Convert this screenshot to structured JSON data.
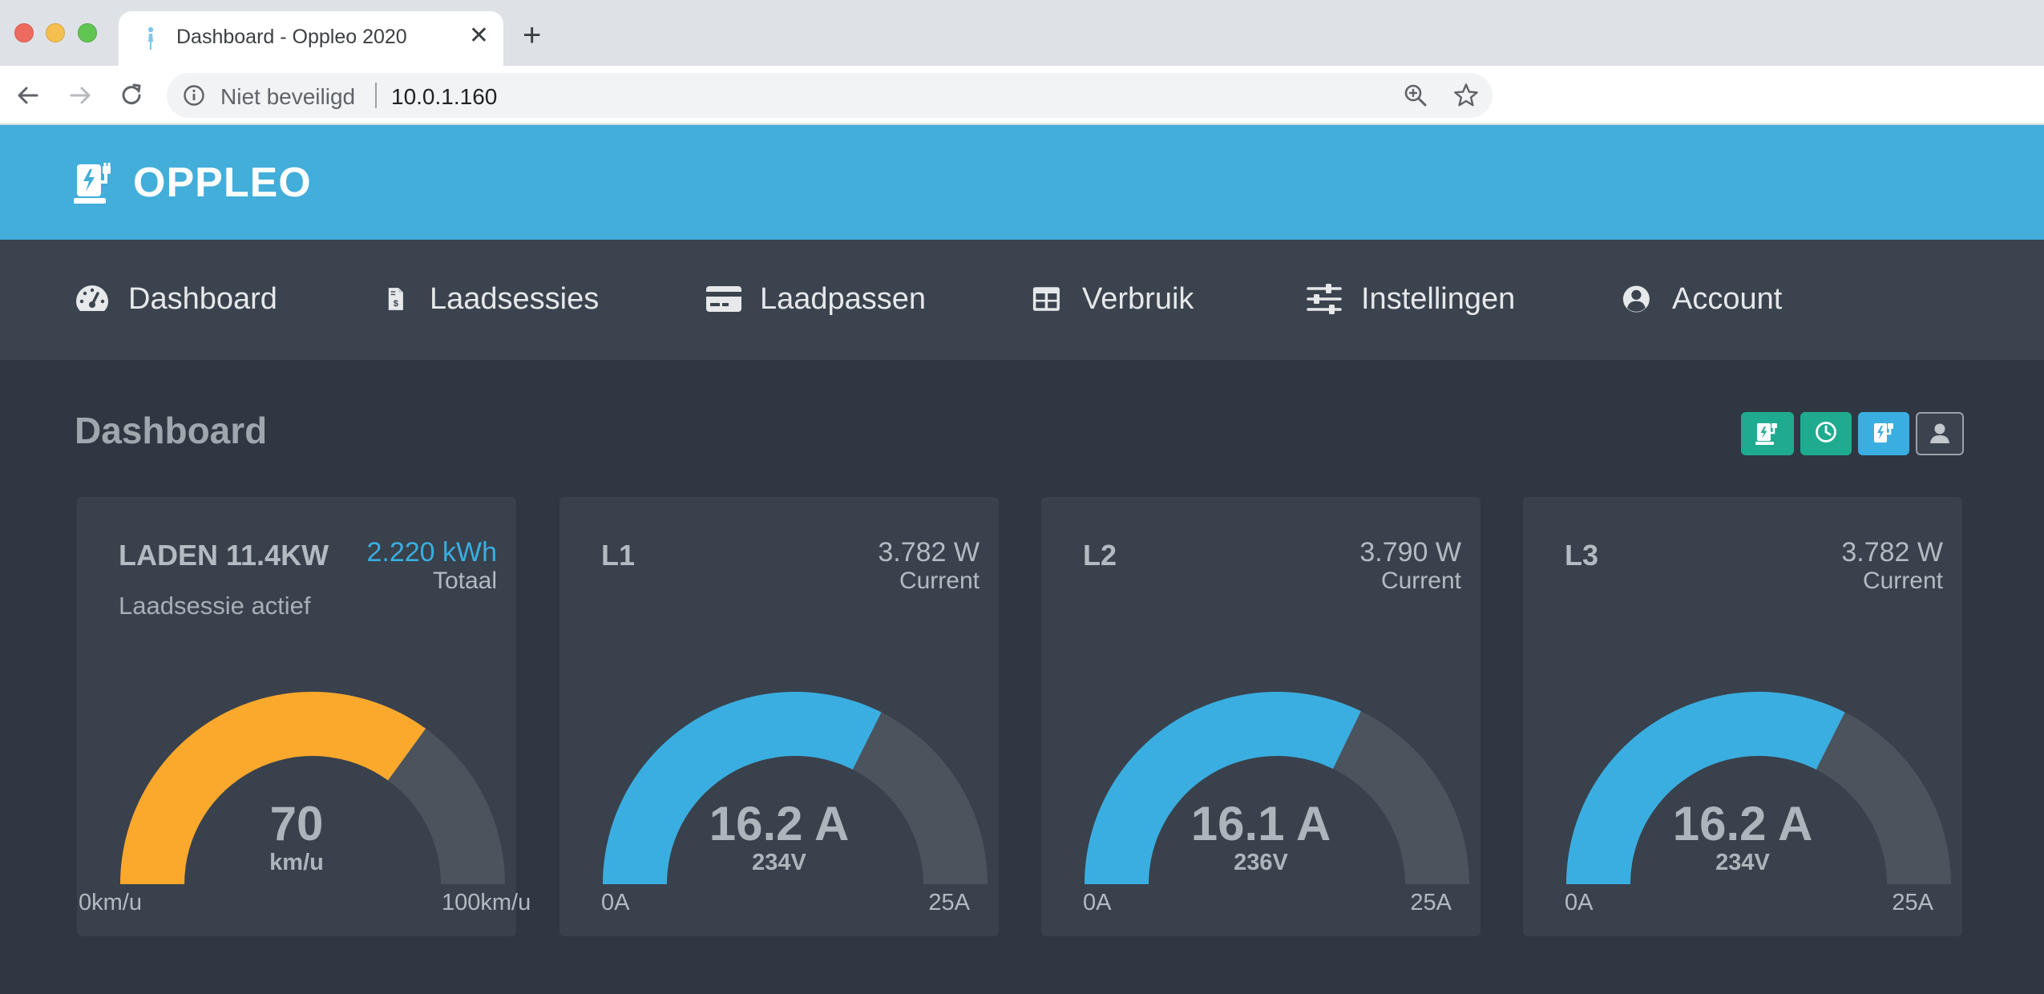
{
  "browser": {
    "tab_title": "Dashboard - Oppleo 2020",
    "address": {
      "security_label": "Niet beveiligd",
      "url": "10.0.1.160"
    },
    "icons": [
      "back-icon",
      "forward-icon",
      "reload-icon",
      "info-icon",
      "zoom-icon",
      "star-icon",
      "close-icon",
      "plus-icon"
    ]
  },
  "app": {
    "brand": "OPPLEO",
    "accent_color": "#42aed9"
  },
  "nav": {
    "items": [
      {
        "label": "Dashboard",
        "icon": "speedometer-icon"
      },
      {
        "label": "Laadsessies",
        "icon": "invoice-icon"
      },
      {
        "label": "Laadpassen",
        "icon": "credit-card-icon"
      },
      {
        "label": "Verbruik",
        "icon": "table-icon"
      },
      {
        "label": "Instellingen",
        "icon": "sliders-icon"
      },
      {
        "label": "Account",
        "icon": "user-circle-icon"
      }
    ]
  },
  "page": {
    "title": "Dashboard",
    "quick_actions": [
      {
        "icon": "charger-icon",
        "color": "#1fab8f"
      },
      {
        "icon": "clock-icon",
        "color": "#1fab8f"
      },
      {
        "icon": "fuel-station-icon",
        "color": "#3aaee0"
      },
      {
        "icon": "user-icon",
        "color": "#3a434e"
      }
    ]
  },
  "cards": [
    {
      "title": "LADEN 11.4KW",
      "value": "2.220 kWh",
      "unit": "Totaal",
      "subtitle": "Laadsessie actief",
      "gauge": {
        "value": 70,
        "min": 0,
        "max": 100,
        "display": "70",
        "sub": "km/u",
        "min_label": "0km/u",
        "max_label": "100km/u",
        "color": "#fba92c"
      }
    },
    {
      "title": "L1",
      "value": "3.782 W",
      "unit": "Current",
      "gauge": {
        "value": 16.2,
        "min": 0,
        "max": 25,
        "display": "16.2 A",
        "sub": "234V",
        "min_label": "0A",
        "max_label": "25A",
        "color": "#3aaee0"
      }
    },
    {
      "title": "L2",
      "value": "3.790 W",
      "unit": "Current",
      "gauge": {
        "value": 16.1,
        "min": 0,
        "max": 25,
        "display": "16.1 A",
        "sub": "236V",
        "min_label": "0A",
        "max_label": "25A",
        "color": "#3aaee0"
      }
    },
    {
      "title": "L3",
      "value": "3.782 W",
      "unit": "Current",
      "gauge": {
        "value": 16.2,
        "min": 0,
        "max": 25,
        "display": "16.2 A",
        "sub": "234V",
        "min_label": "0A",
        "max_label": "25A",
        "color": "#3aaee0"
      }
    }
  ]
}
